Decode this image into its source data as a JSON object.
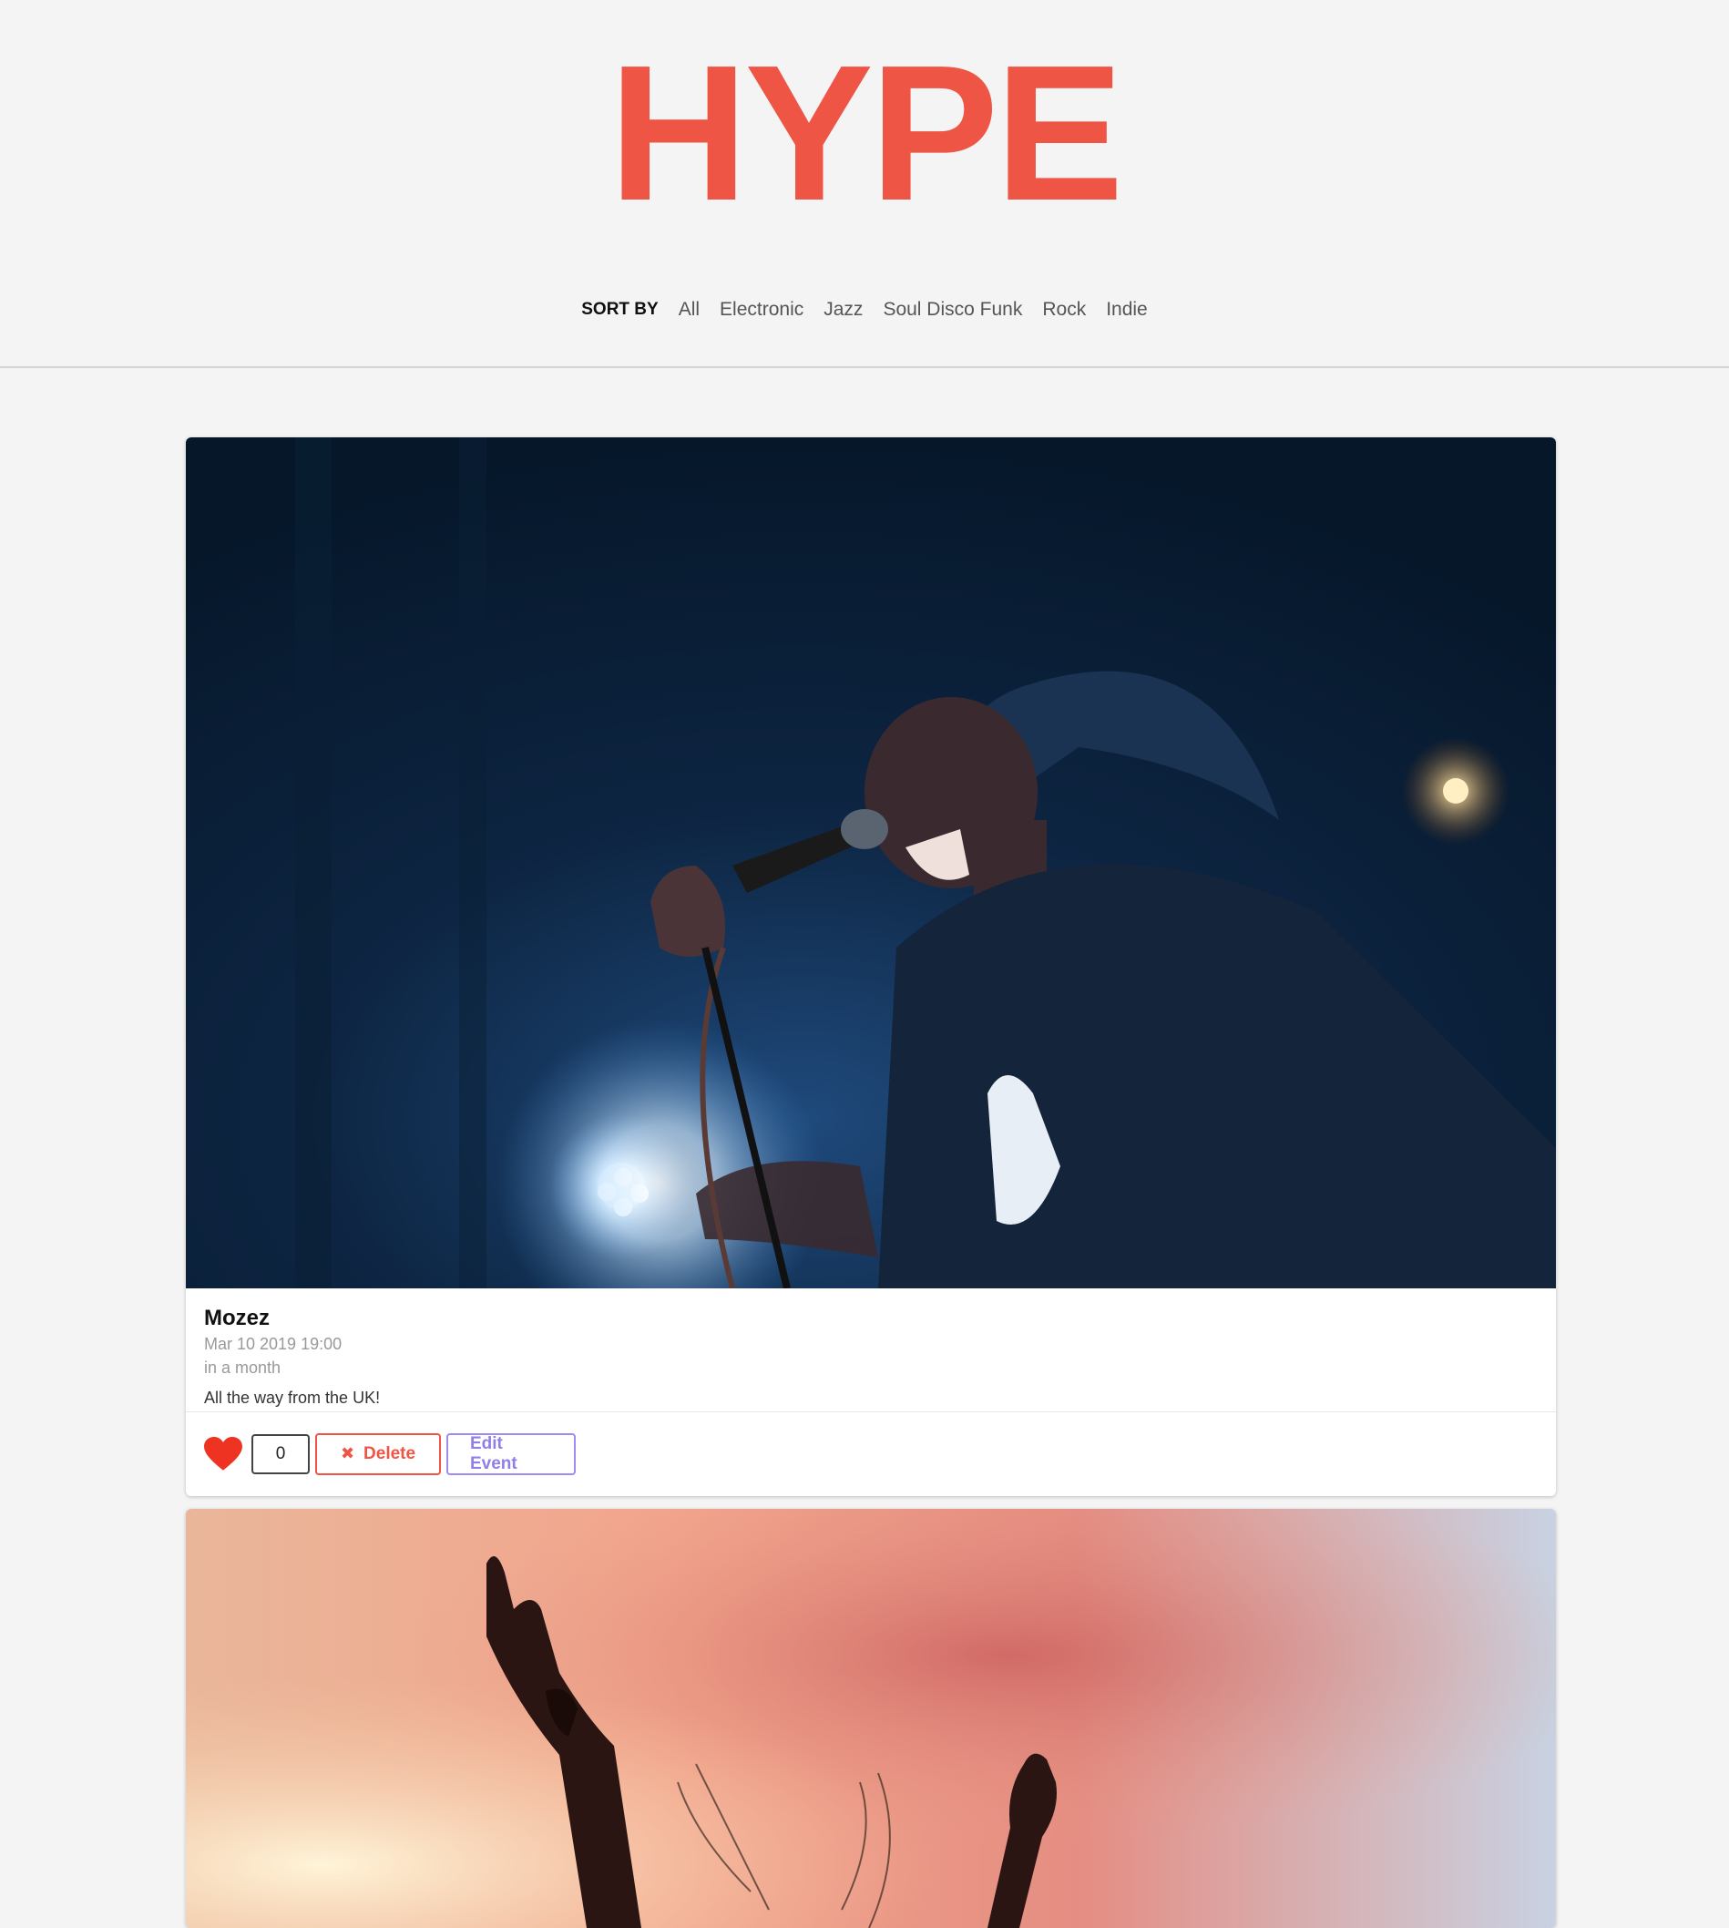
{
  "header": {
    "logo": "HYPE"
  },
  "sort": {
    "label": "SORT BY",
    "options": [
      "All",
      "Electronic",
      "Jazz",
      "Soul Disco Funk",
      "Rock",
      "Indie"
    ]
  },
  "events": [
    {
      "title": "Mozez",
      "date": "Mar 10 2019 19:00",
      "relative": "in a month",
      "description": "All the way from the UK!",
      "likes": "0",
      "delete_label": "Delete",
      "edit_label": "Edit Event"
    }
  ],
  "icons": {
    "heart": "heart-icon",
    "delete": "x-icon"
  },
  "colors": {
    "brand": "#ee5544",
    "heart": "#ee3322",
    "edit": "#8e80e8",
    "background": "#f4f4f4"
  }
}
